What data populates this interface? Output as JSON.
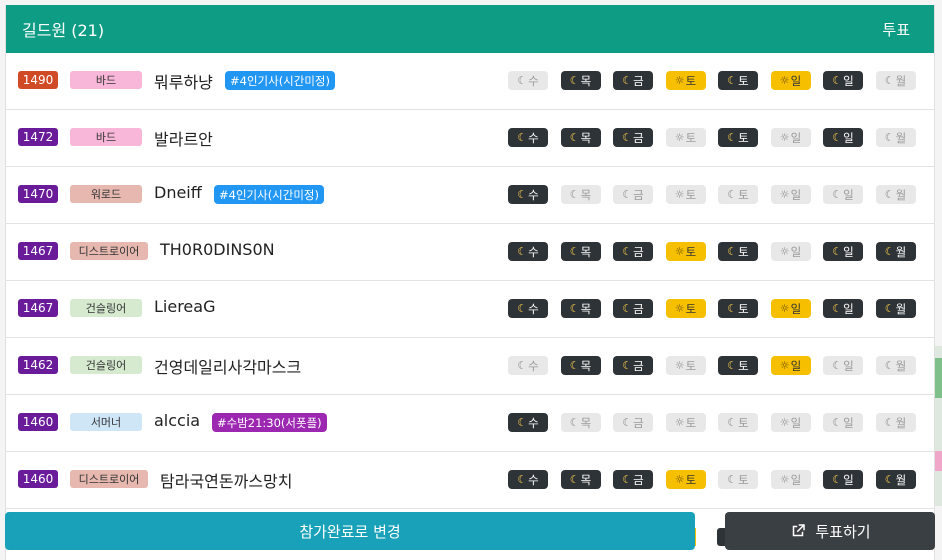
{
  "header": {
    "title": "길드원 (21)",
    "vote_label": "투표"
  },
  "days": [
    "수",
    "목",
    "금",
    "토",
    "토",
    "일",
    "일",
    "월"
  ],
  "colors": {
    "header": "#0e9c84",
    "moon_on": "#2e3338",
    "sun_on": "#f6c000",
    "off": "#e8e8e8",
    "primary_button": "#18a1b8",
    "vote_button": "#3a3f44"
  },
  "members": [
    {
      "score": "1490",
      "score_color": "#d04a26",
      "class": "바드",
      "class_bg": "#f8b6d8",
      "class_fg": "#333",
      "name": "뭐루하냥",
      "tag": "#4인기사(시간미정)",
      "tag_color": "#2196f3",
      "states": [
        0,
        1,
        1,
        1,
        1,
        1,
        1,
        0
      ]
    },
    {
      "score": "1472",
      "score_color": "#6a1b9a",
      "class": "바드",
      "class_bg": "#f8b6d8",
      "class_fg": "#333",
      "name": "발라르안",
      "tag": "",
      "tag_color": "",
      "states": [
        1,
        1,
        1,
        0,
        1,
        0,
        1,
        0
      ]
    },
    {
      "score": "1470",
      "score_color": "#6a1b9a",
      "class": "워로드",
      "class_bg": "#e6b8b0",
      "class_fg": "#333",
      "name": "Dneiff",
      "tag": "#4인기사(시간미정)",
      "tag_color": "#2196f3",
      "states": [
        1,
        0,
        0,
        0,
        0,
        0,
        0,
        0
      ]
    },
    {
      "score": "1467",
      "score_color": "#6a1b9a",
      "class": "디스트로이어",
      "class_bg": "#e6b8b0",
      "class_fg": "#333",
      "name": "TH0R0DINS0N",
      "tag": "",
      "tag_color": "",
      "states": [
        1,
        1,
        1,
        1,
        1,
        0,
        1,
        1
      ]
    },
    {
      "score": "1467",
      "score_color": "#6a1b9a",
      "class": "건슬링어",
      "class_bg": "#d6ead0",
      "class_fg": "#333",
      "name": "LiereaG",
      "tag": "",
      "tag_color": "",
      "states": [
        1,
        1,
        1,
        1,
        1,
        1,
        1,
        1
      ]
    },
    {
      "score": "1462",
      "score_color": "#6a1b9a",
      "class": "건슬링어",
      "class_bg": "#d6ead0",
      "class_fg": "#333",
      "name": "건영데일리사각마스크",
      "tag": "",
      "tag_color": "",
      "states": [
        0,
        1,
        1,
        0,
        1,
        1,
        0,
        0
      ]
    },
    {
      "score": "1460",
      "score_color": "#6a1b9a",
      "class": "서머너",
      "class_bg": "#cfe6f7",
      "class_fg": "#333",
      "name": "alccia",
      "tag": "#수밤21:30(서폿플)",
      "tag_color": "#9c27b0",
      "states": [
        1,
        0,
        0,
        0,
        0,
        0,
        0,
        0
      ]
    },
    {
      "score": "1460",
      "score_color": "#6a1b9a",
      "class": "디스트로이어",
      "class_bg": "#e6b8b0",
      "class_fg": "#333",
      "name": "탐라국연돈까스망치",
      "tag": "",
      "tag_color": "",
      "states": [
        1,
        1,
        1,
        1,
        0,
        0,
        1,
        1
      ]
    }
  ],
  "buttons": {
    "complete_label": "참가완료로 변경",
    "vote_label": "투표하기"
  }
}
